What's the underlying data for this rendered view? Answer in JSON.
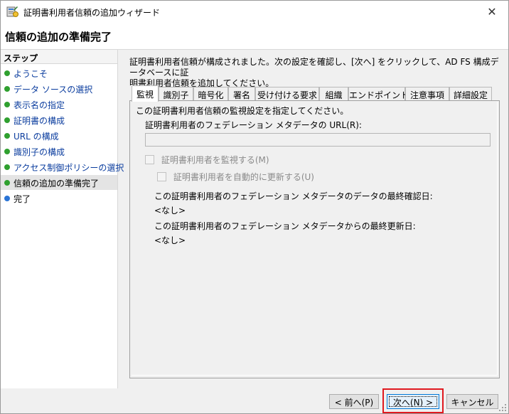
{
  "window": {
    "title": "証明書利用者信頼の追加ウィザード",
    "close_glyph": "✕",
    "app_icon": "wizard-icon"
  },
  "header": {
    "title": "信頼の追加の準備完了"
  },
  "steps": {
    "heading": "ステップ",
    "items": [
      {
        "label": "ようこそ",
        "state": "done"
      },
      {
        "label": "データ ソースの選択",
        "state": "done"
      },
      {
        "label": "表示名の指定",
        "state": "done"
      },
      {
        "label": "証明書の構成",
        "state": "done"
      },
      {
        "label": "URL の構成",
        "state": "done"
      },
      {
        "label": "識別子の構成",
        "state": "done"
      },
      {
        "label": "アクセス制御ポリシーの選択",
        "state": "done"
      },
      {
        "label": "信頼の追加の準備完了",
        "state": "current"
      },
      {
        "label": "完了",
        "state": "pending"
      }
    ]
  },
  "intro": {
    "line1": "証明書利用者信頼が構成されました。次の設定を確認し、[次へ] をクリックして、AD FS 構成データベースに証",
    "line2": "明書利用者信頼を追加してください。"
  },
  "tabs": {
    "items": [
      "監視",
      "識別子",
      "暗号化",
      "署名",
      "受け付ける要求",
      "組織",
      "エンドポイント",
      "注意事項",
      "詳細設定"
    ],
    "active_index": 0
  },
  "monitor": {
    "description": "この証明書利用者信頼の監視設定を指定してください。",
    "url_label": "証明書利用者のフェデレーション メタデータの URL(R):",
    "url_value": "",
    "monitor_checkbox": "証明書利用者を監視する(M)",
    "auto_update_checkbox": "証明書利用者を自動的に更新する(U)",
    "last_checked_label": "この証明書利用者のフェデレーション メタデータのデータの最終確認日:",
    "last_checked_value": "<なし>",
    "last_updated_label": "この証明書利用者のフェデレーション メタデータからの最終更新日:",
    "last_updated_value": "<なし>"
  },
  "buttons": {
    "back": "< 前へ(P)",
    "next": "次へ(N) >",
    "cancel": "キャンセル"
  },
  "colors": {
    "highlight": "#e0191f",
    "done_dot": "#2fa02f",
    "pending_dot": "#2a74d6"
  }
}
